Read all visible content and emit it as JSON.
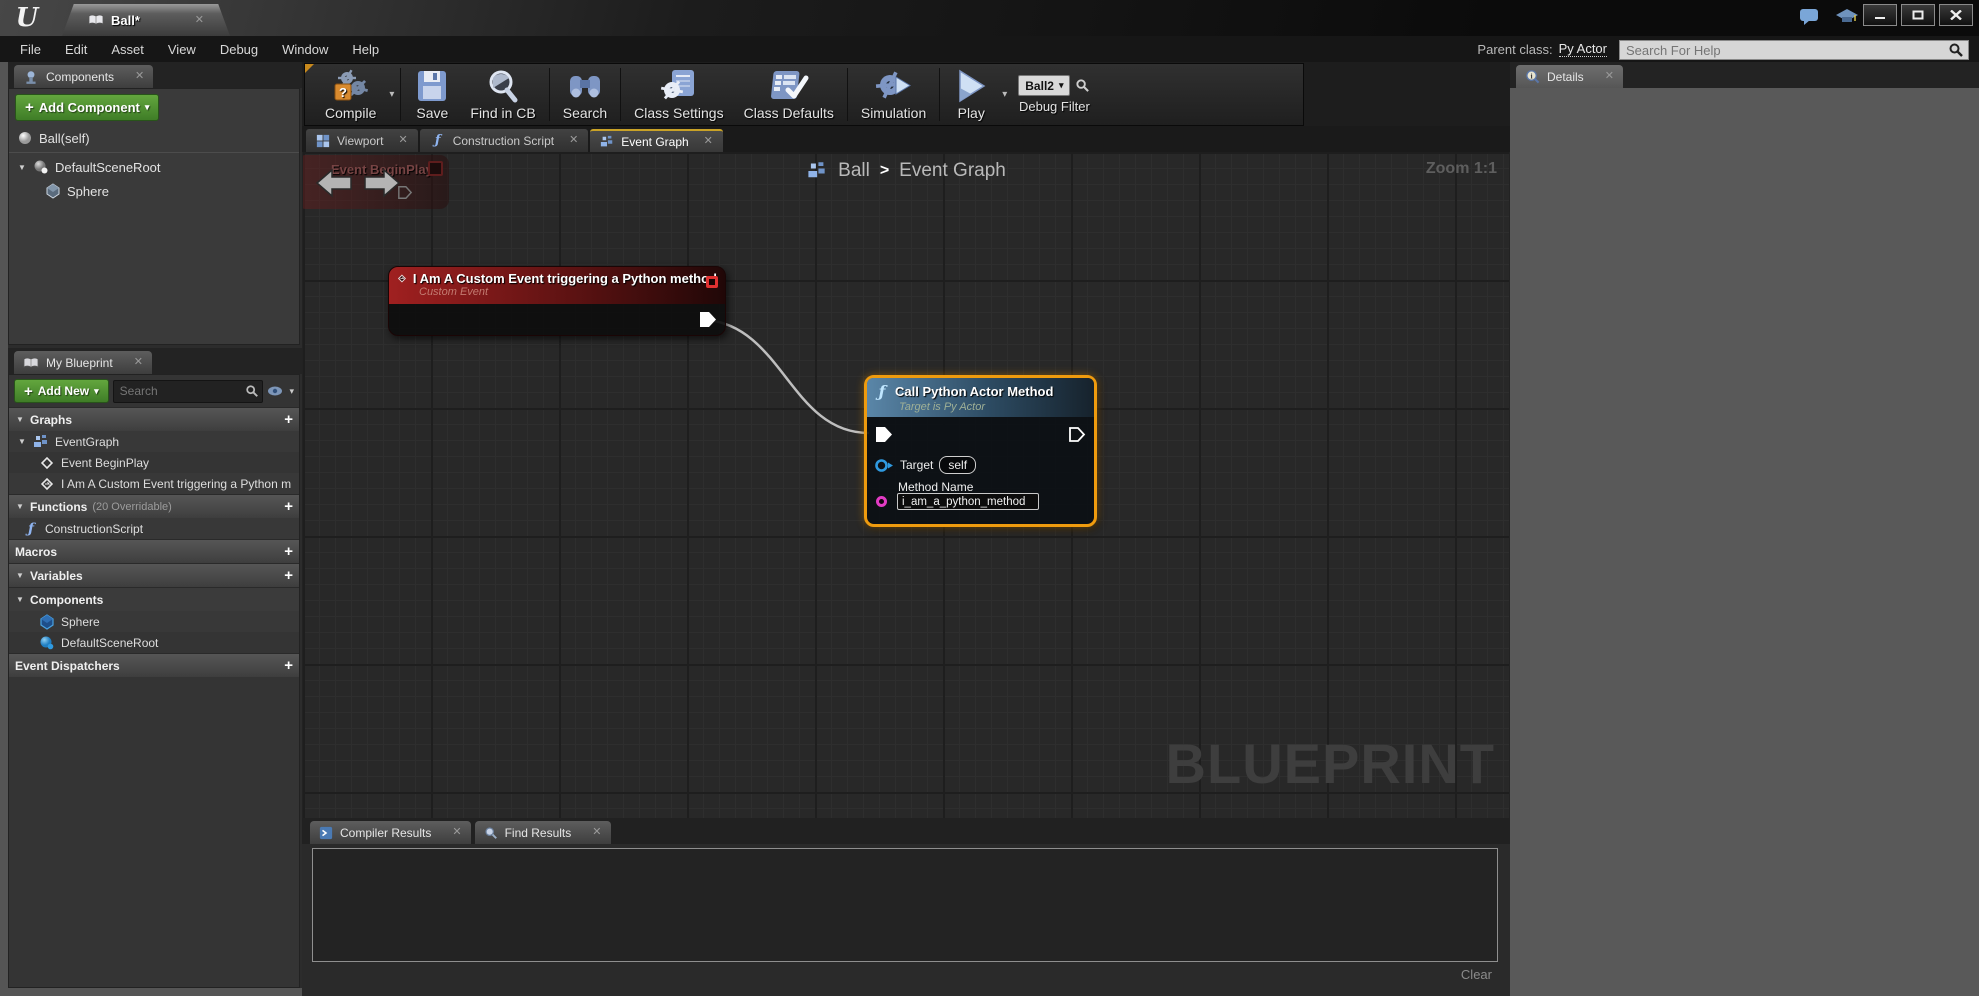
{
  "icons": {
    "close": "✕",
    "caret_down": "▾",
    "plus": "+",
    "expanded": "▼",
    "collapsed": "▶",
    "breadcrumb_separator": "›"
  },
  "colors": {
    "selection_orange": "#ef9b0e",
    "event_node_red": "#a02020",
    "function_node_blue": "#5a86a8",
    "exec_wire": "#d8d8d8",
    "target_pin_blue": "#2f9ae0",
    "method_pin_magenta": "#e23bc4",
    "add_button_green": "#4c9033",
    "tab_highlight_yellow": "#c9a227"
  },
  "window": {
    "tab_title": "Ball*",
    "menus": [
      "File",
      "Edit",
      "Asset",
      "View",
      "Debug",
      "Window",
      "Help"
    ],
    "parent_class_label": "Parent class:",
    "parent_class_value": "Py Actor",
    "help_search_placeholder": "Search For Help"
  },
  "toolbar": {
    "buttons": [
      {
        "label": "Compile",
        "icon": "compile-gears-icon",
        "has_dropdown": true
      },
      {
        "label": "Save",
        "icon": "save-floppy-icon",
        "has_dropdown": false
      },
      {
        "label": "Find in CB",
        "icon": "magnifier-icon",
        "has_dropdown": false
      },
      {
        "label": "Search",
        "icon": "binoculars-icon",
        "has_dropdown": false
      },
      {
        "label": "Class Settings",
        "icon": "class-settings-gear-icon",
        "has_dropdown": false
      },
      {
        "label": "Class Defaults",
        "icon": "class-defaults-list-icon",
        "has_dropdown": false
      },
      {
        "label": "Simulation",
        "icon": "simulation-gear-play-icon",
        "has_dropdown": false
      },
      {
        "label": "Play",
        "icon": "play-triangle-icon",
        "has_dropdown": true
      }
    ],
    "debug_target": "Ball2",
    "debug_filter_label": "Debug Filter"
  },
  "components_panel": {
    "tab_label": "Components",
    "add_button_label": "Add Component",
    "items": [
      {
        "label": "Ball(self)",
        "icon": "white-sphere-icon"
      },
      {
        "label": "DefaultSceneRoot",
        "icon": "scene-root-sphere-icon"
      },
      {
        "label": "Sphere",
        "icon": "static-mesh-icon"
      }
    ]
  },
  "my_blueprint": {
    "tab_label": "My Blueprint",
    "add_button_label": "Add New",
    "search_placeholder": "Search",
    "sections": {
      "graphs": "Graphs",
      "functions": "Functions",
      "functions_note": "(20 Overridable)",
      "macros": "Macros",
      "variables": "Variables",
      "components": "Components",
      "event_dispatchers": "Event Dispatchers"
    },
    "graph_items": [
      {
        "label": "EventGraph",
        "icon": "eventgraph-icon"
      },
      {
        "label": "Event BeginPlay",
        "icon": "event-diamond-icon"
      },
      {
        "label": "I Am A Custom Event triggering a Python m",
        "icon": "event-diamond-icon"
      }
    ],
    "function_items": [
      {
        "label": "ConstructionScript",
        "icon": "function-f-icon"
      }
    ],
    "component_items": [
      {
        "label": "Sphere",
        "icon": "static-mesh-icon"
      },
      {
        "label": "DefaultSceneRoot",
        "icon": "scene-root-sphere-icon"
      }
    ]
  },
  "graph": {
    "tabs": [
      {
        "label": "Viewport",
        "icon": "viewport-grid-icon",
        "active": false
      },
      {
        "label": "Construction Script",
        "icon": "function-f-icon",
        "active": false
      },
      {
        "label": "Event Graph",
        "icon": "eventgraph-icon",
        "active": true
      }
    ],
    "breadcrumb": {
      "root": "Ball",
      "separator": ">",
      "current": "Event Graph"
    },
    "zoom_label": "Zoom 1:1",
    "watermark": "BLUEPRINT",
    "ghost_node_title": "Event BeginPlay",
    "custom_event_node": {
      "title": "I Am A Custom Event triggering a Python method",
      "subtitle": "Custom Event"
    },
    "call_node": {
      "title": "Call Python Actor Method",
      "subtitle": "Target is Py Actor",
      "target_label": "Target",
      "target_value": "self",
      "method_label": "Method Name",
      "method_value": "i_am_a_python_method"
    }
  },
  "bottom_panel": {
    "tabs": [
      {
        "label": "Compiler Results",
        "icon": "compiler-console-icon"
      },
      {
        "label": "Find Results",
        "icon": "magnifier-icon"
      }
    ],
    "clear_label": "Clear"
  },
  "details_panel": {
    "tab_label": "Details"
  }
}
